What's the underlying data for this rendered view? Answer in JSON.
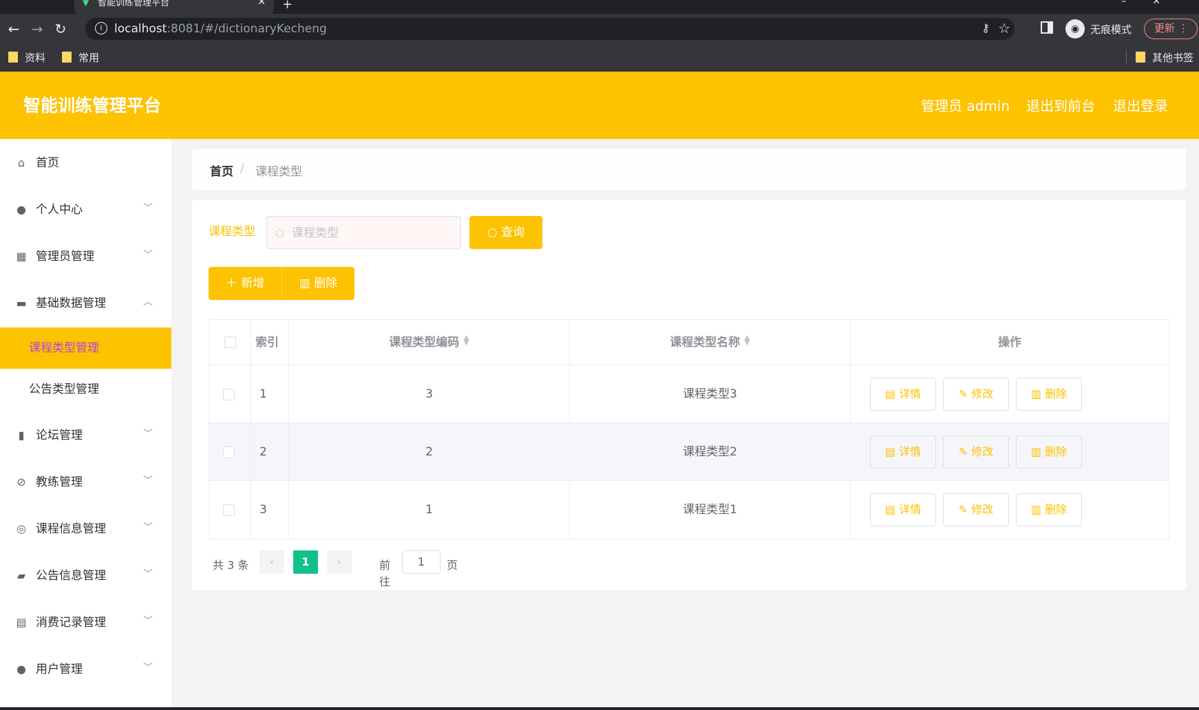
{
  "browser": {
    "tab_title": "智能训练管理平台",
    "url_host": "localhost",
    "url_path": ":8081/#/dictionaryKecheng",
    "incognito_label": "无痕模式",
    "update_label": "更新",
    "bookmarks": [
      "资料",
      "常用"
    ],
    "other_bookmarks": "其他书签"
  },
  "header": {
    "title": "智能训练管理平台",
    "user": "管理员 admin",
    "to_front": "退出到前台",
    "logout": "退出登录"
  },
  "sidebar": {
    "items": [
      {
        "label": "首页",
        "icon": "home-icon"
      },
      {
        "label": "个人中心",
        "icon": "user-icon"
      },
      {
        "label": "管理员管理",
        "icon": "grid-icon"
      },
      {
        "label": "基础数据管理",
        "icon": "monitor-icon"
      },
      {
        "label": "论坛管理",
        "icon": "bar-chart-icon"
      },
      {
        "label": "教练管理",
        "icon": "bell-off-icon"
      },
      {
        "label": "课程信息管理",
        "icon": "compass-icon"
      },
      {
        "label": "公告信息管理",
        "icon": "briefcase-icon"
      },
      {
        "label": "消费记录管理",
        "icon": "clipboard-icon"
      },
      {
        "label": "用户管理",
        "icon": "balloon-icon"
      }
    ],
    "sub_items": [
      {
        "label": "课程类型管理",
        "active": true
      },
      {
        "label": "公告类型管理",
        "active": false
      }
    ]
  },
  "breadcrumb": {
    "home": "首页",
    "separator": "/",
    "current": "课程类型"
  },
  "search": {
    "label": "课程类型",
    "placeholder": "课程类型",
    "query_button": "查询"
  },
  "actions": {
    "add": "新增",
    "delete": "删除"
  },
  "table": {
    "headers": [
      "索引",
      "课程类型编码",
      "课程类型名称",
      "操作"
    ],
    "rows": [
      {
        "index": "1",
        "code": "3",
        "name": "课程类型3"
      },
      {
        "index": "2",
        "code": "2",
        "name": "课程类型2"
      },
      {
        "index": "3",
        "code": "1",
        "name": "课程类型1"
      }
    ],
    "op_labels": {
      "detail": "详情",
      "edit": "修改",
      "delete": "删除"
    }
  },
  "pagination": {
    "total": "共 3 条",
    "current_page": "1",
    "goto_label": "前往",
    "goto_value": "1",
    "page_suffix": "页"
  },
  "colors": {
    "primary": "#fdc200",
    "active_text": "#b04bd5",
    "page_active": "#13c08c"
  }
}
